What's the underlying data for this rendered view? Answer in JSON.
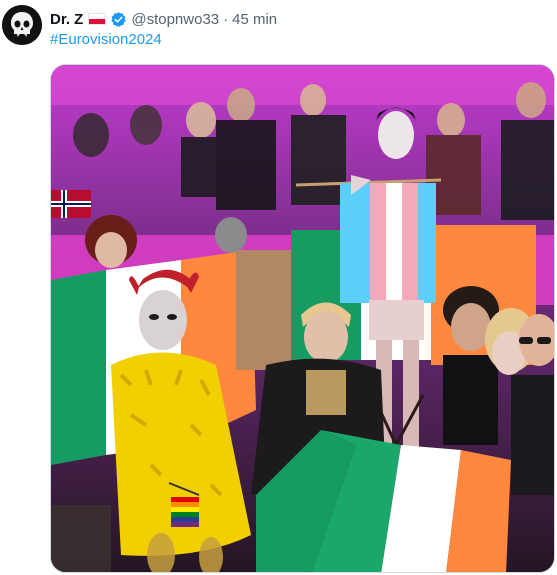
{
  "tweet": {
    "author_name": "Dr. Z",
    "handle": "@stopnwo33",
    "separator": "·",
    "time": "45 min",
    "hashtag": "#Eurovision2024"
  },
  "icons": {
    "avatar": "skull-avatar-icon",
    "flag": "poland-flag-icon",
    "verified": "verified-badge-icon"
  },
  "colors": {
    "link": "#1d9bf0",
    "verified": "#1d9bf0",
    "muted_text": "#536471",
    "ireland_green": "#169b62",
    "ireland_orange": "#ff883e",
    "stage_pink": "#e040c8"
  }
}
